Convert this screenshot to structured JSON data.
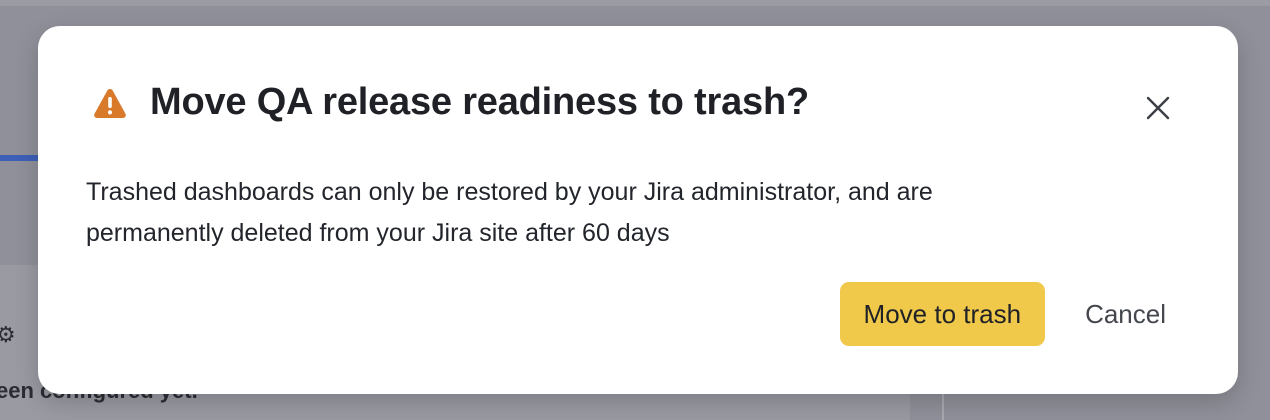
{
  "background": {
    "partial_text": "een configured yet.",
    "partial_icon": "gear-icon"
  },
  "dialog": {
    "title": "Move QA release readiness to trash?",
    "icon": "warning-icon",
    "message_line1": "Trashed dashboards can only be restored by your Jira administrator, and are",
    "message_line2": "permanently deleted from your Jira site after 60 days",
    "close_icon": "close-icon",
    "primary_label": "Move to trash",
    "secondary_label": "Cancel"
  },
  "colors": {
    "overlay": "#8f9099",
    "warning": "#d97a2b",
    "primary_button": "#f0c94a",
    "title_text": "#1f2126"
  }
}
